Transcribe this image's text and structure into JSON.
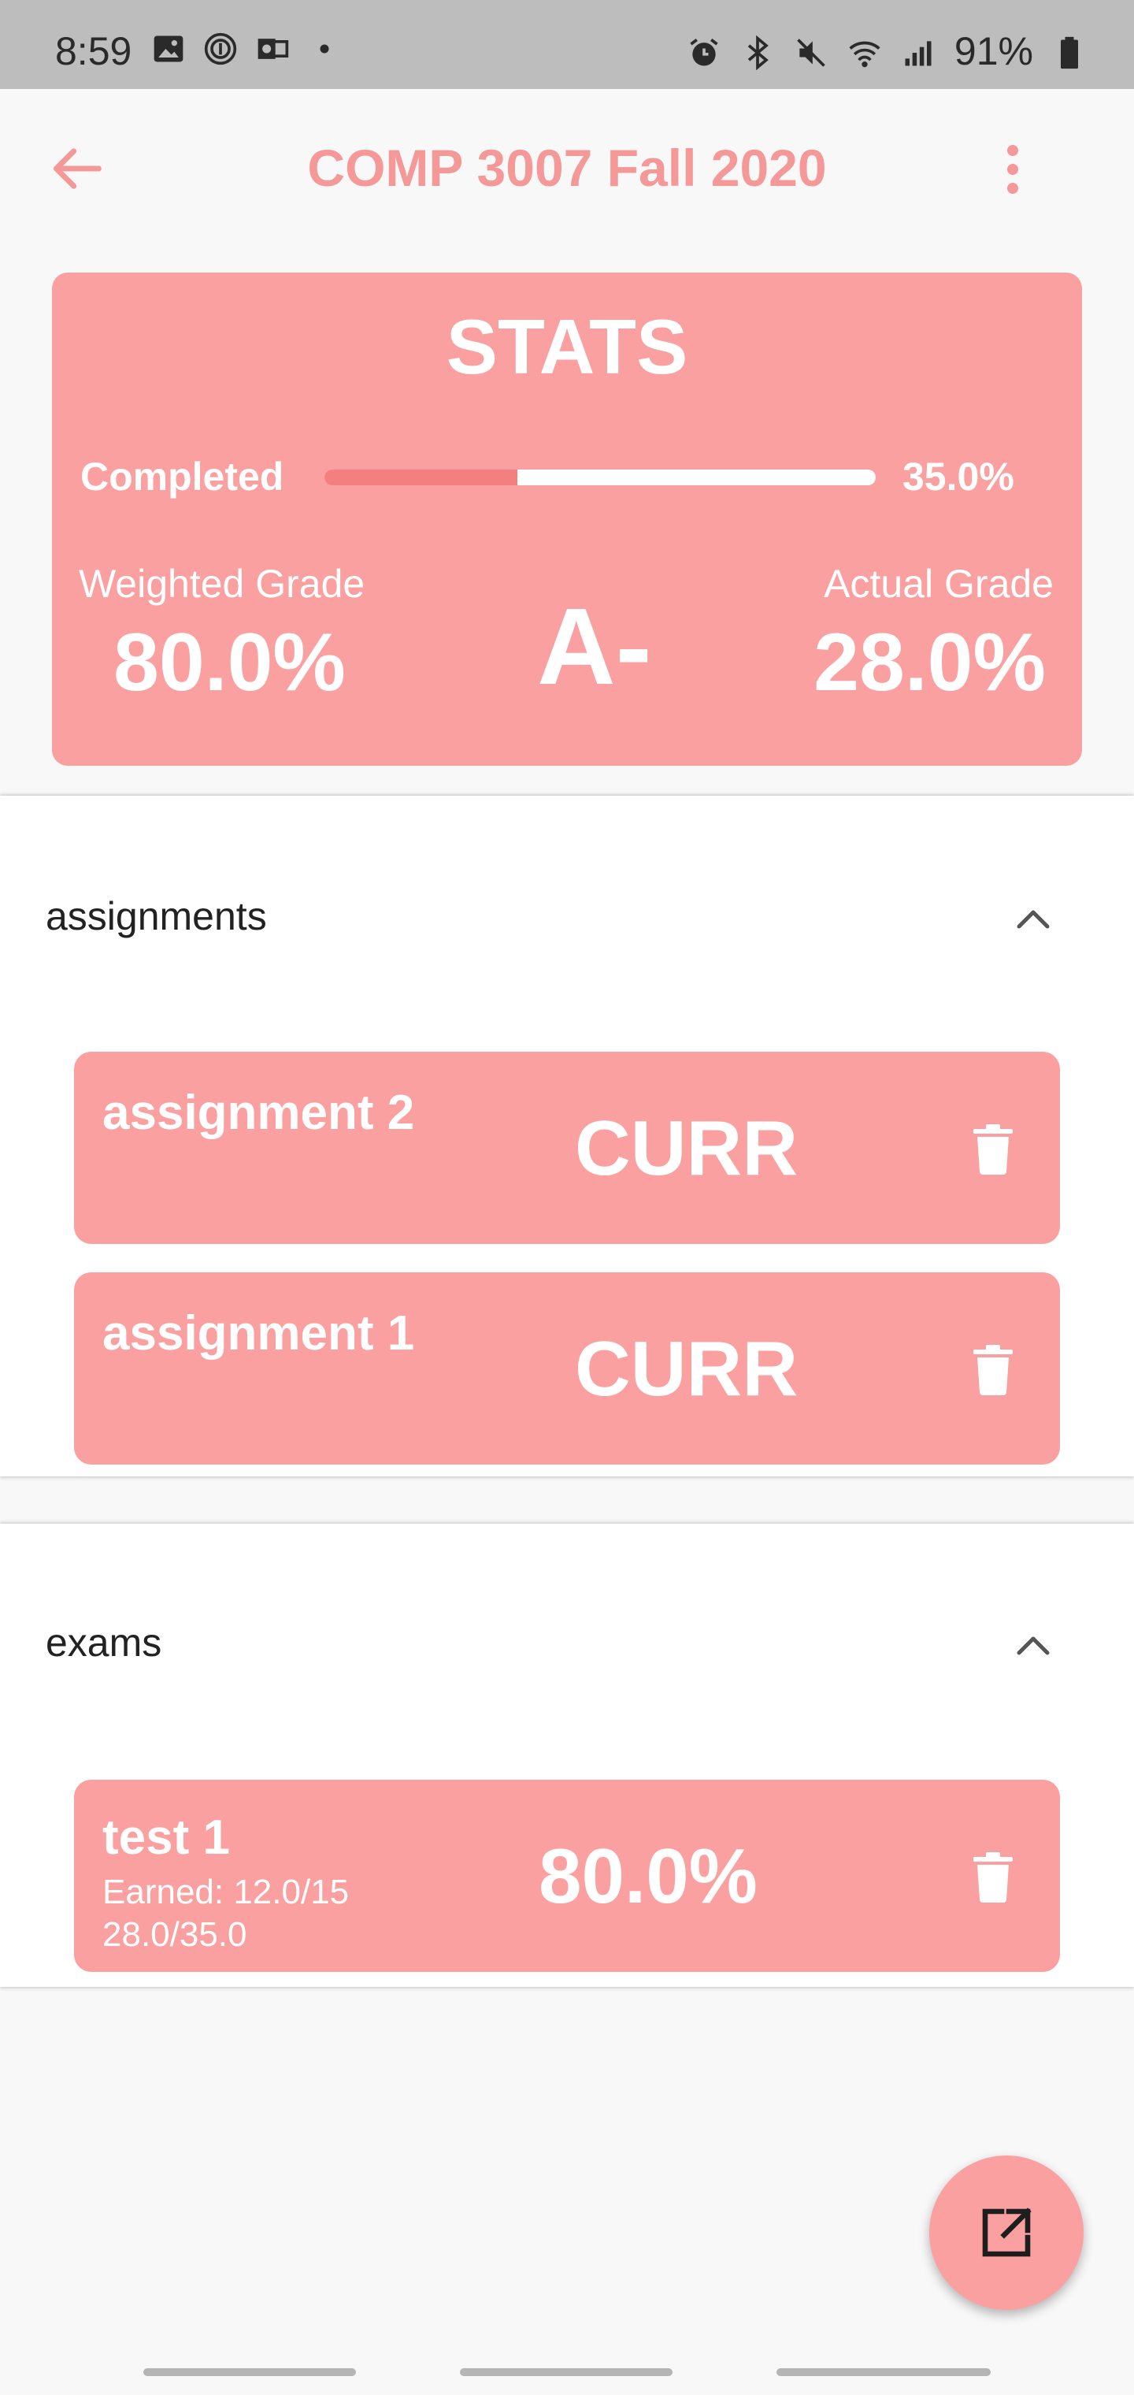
{
  "status_bar": {
    "time": "8:59",
    "battery": "91%",
    "left_icons": [
      "image-icon",
      "fingerprint-icon",
      "outlook-icon",
      "dot-icon"
    ],
    "right_icons": [
      "alarm-icon",
      "bluetooth-icon",
      "mute-icon",
      "wifi-icon",
      "signal-icon",
      "battery-icon"
    ]
  },
  "app_bar": {
    "title": "COMP 3007 Fall 2020",
    "back_icon": "arrow-left-icon",
    "menu_icon": "more-vertical-icon"
  },
  "stats": {
    "title": "STATS",
    "completed_label": "Completed",
    "completed_percent_text": "35.0%",
    "completed_fraction": 0.35,
    "weighted_grade_label": "Weighted Grade",
    "weighted_grade_value": "80.0%",
    "letter_grade": "A-",
    "actual_grade_label": "Actual Grade",
    "actual_grade_value": "28.0%"
  },
  "sections": [
    {
      "title": "assignments",
      "items": [
        {
          "name": "assignment 2",
          "status": "CURR"
        },
        {
          "name": "assignment 1",
          "status": "CURR"
        }
      ]
    },
    {
      "title": "exams",
      "items": [
        {
          "name": "test 1",
          "earned": "Earned: 12.0/15",
          "weight": "28.0/35.0",
          "status": "80.0%"
        }
      ]
    }
  ],
  "colors": {
    "accent": "#f49898",
    "card": "#fba0a0",
    "progress_fill": "#f47f7f",
    "status_bar": "#bdbdbd",
    "background": "#f8f8f8"
  }
}
